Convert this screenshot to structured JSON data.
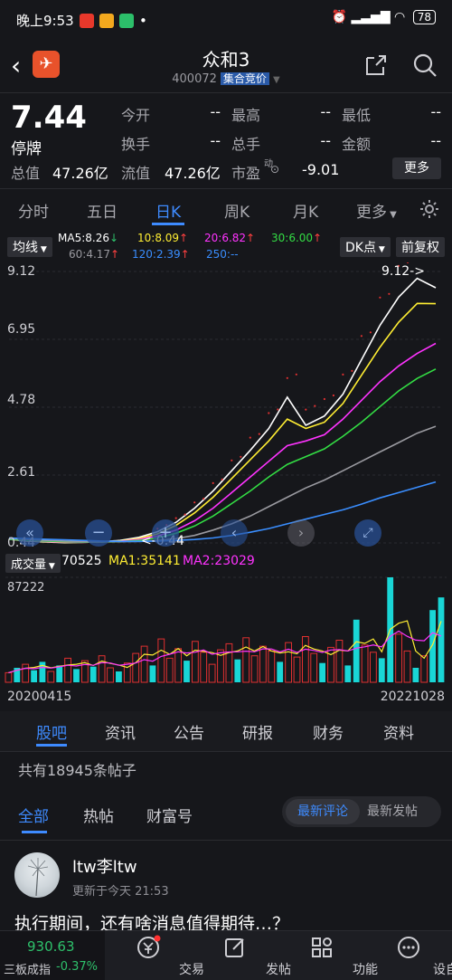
{
  "status_bar": {
    "time": "晚上9:53",
    "dot": "•",
    "battery": "78"
  },
  "header": {
    "title": "众和3",
    "code": "400072",
    "badge": "集合竞价"
  },
  "quote": {
    "price": "7.44",
    "state": "停牌",
    "fields": [
      {
        "label": "今开",
        "value": "--"
      },
      {
        "label": "最高",
        "value": "--"
      },
      {
        "label": "最低",
        "value": "--"
      },
      {
        "label": "换手",
        "value": "--"
      },
      {
        "label": "总手",
        "value": "--"
      },
      {
        "label": "金额",
        "value": "--"
      }
    ],
    "total_value_label": "总值",
    "total_value": "47.26亿",
    "float_value_label": "流值",
    "float_value": "47.26亿",
    "pe_label": "市盈",
    "pe_sup": "动",
    "pe_value": "-9.01",
    "more_label": "更多"
  },
  "chart_tabs": [
    {
      "label": "分时"
    },
    {
      "label": "五日"
    },
    {
      "label": "日K"
    },
    {
      "label": "周K"
    },
    {
      "label": "月K"
    },
    {
      "label": "更多"
    }
  ],
  "ma": {
    "selector": "均线",
    "ma5": "MA5:8.26",
    "ma10": "10:8.09",
    "ma20": "20:6.82",
    "ma30": "30:6.00",
    "ma60": "60:4.17",
    "ma120": "120:2.39",
    "ma250": "250:--",
    "dk_label": "DK点",
    "adjust_label": "前复权",
    "colors": {
      "ma5": "#ffffff",
      "ma10": "#ffee33",
      "ma20": "#ff33ff",
      "ma30": "#33dd44",
      "ma60": "#9a9aa0",
      "ma120": "#3a8eff",
      "ma250": "#3a8eff"
    }
  },
  "chart_data": {
    "type": "line",
    "title": "",
    "x_start": "20200415",
    "x_end": "20221028",
    "ylim": [
      0.44,
      9.12
    ],
    "y_ticks": [
      "9.12",
      "6.95",
      "4.78",
      "2.61",
      "0.44"
    ],
    "max_marker": "9.12->",
    "min_marker": "<-0.44",
    "series": [
      {
        "name": "MA5",
        "color": "#ffffff",
        "values": [
          0.56,
          0.5,
          0.47,
          0.45,
          0.46,
          0.48,
          0.52,
          0.62,
          0.8,
          1.1,
          1.55,
          2.1,
          2.75,
          3.4,
          4.1,
          5.1,
          4.2,
          4.5,
          5.2,
          6.3,
          7.4,
          8.3,
          8.9,
          8.6
        ]
      },
      {
        "name": "MA10",
        "color": "#ffee33",
        "values": [
          0.56,
          0.51,
          0.48,
          0.46,
          0.46,
          0.47,
          0.5,
          0.58,
          0.73,
          1.0,
          1.4,
          1.9,
          2.5,
          3.1,
          3.7,
          4.4,
          4.1,
          4.3,
          4.9,
          5.8,
          6.7,
          7.5,
          8.1,
          8.09
        ]
      },
      {
        "name": "MA20",
        "color": "#ff33ff",
        "values": [
          0.56,
          0.52,
          0.49,
          0.47,
          0.46,
          0.47,
          0.49,
          0.55,
          0.66,
          0.85,
          1.15,
          1.55,
          2.05,
          2.55,
          3.05,
          3.55,
          3.7,
          3.9,
          4.4,
          5.0,
          5.6,
          6.1,
          6.5,
          6.82
        ]
      },
      {
        "name": "MA30",
        "color": "#33dd44",
        "values": [
          0.56,
          0.52,
          0.5,
          0.48,
          0.47,
          0.47,
          0.48,
          0.52,
          0.6,
          0.75,
          0.98,
          1.3,
          1.7,
          2.1,
          2.55,
          2.95,
          3.2,
          3.45,
          3.85,
          4.3,
          4.8,
          5.3,
          5.7,
          6.0
        ]
      },
      {
        "name": "MA60",
        "color": "#9a9aa0",
        "values": [
          0.58,
          0.55,
          0.52,
          0.5,
          0.49,
          0.48,
          0.48,
          0.49,
          0.52,
          0.58,
          0.68,
          0.85,
          1.05,
          1.3,
          1.6,
          1.9,
          2.2,
          2.45,
          2.75,
          3.05,
          3.35,
          3.65,
          3.95,
          4.17
        ]
      },
      {
        "name": "MA120",
        "color": "#3a8eff",
        "values": [
          0.6,
          0.58,
          0.56,
          0.54,
          0.52,
          0.5,
          0.49,
          0.49,
          0.5,
          0.52,
          0.55,
          0.6,
          0.68,
          0.78,
          0.9,
          1.05,
          1.2,
          1.35,
          1.5,
          1.68,
          1.88,
          2.05,
          2.22,
          2.39
        ]
      }
    ]
  },
  "volume": {
    "selector": "成交量",
    "last": "70525",
    "ma1": "MA1:35141",
    "ma2": "MA2:23029",
    "max_label": "87222",
    "max": 87222,
    "bars": [
      {
        "v": 8000,
        "c": "#e03030"
      },
      {
        "v": 12000,
        "c": "#19d6d6"
      },
      {
        "v": 15000,
        "c": "#e03030"
      },
      {
        "v": 10000,
        "c": "#19d6d6"
      },
      {
        "v": 17000,
        "c": "#19d6d6"
      },
      {
        "v": 9000,
        "c": "#e03030"
      },
      {
        "v": 14000,
        "c": "#19d6d6"
      },
      {
        "v": 20000,
        "c": "#e03030"
      },
      {
        "v": 11000,
        "c": "#19d6d6"
      },
      {
        "v": 18000,
        "c": "#e03030"
      },
      {
        "v": 13000,
        "c": "#19d6d6"
      },
      {
        "v": 22000,
        "c": "#e03030"
      },
      {
        "v": 12000,
        "c": "#e03030"
      },
      {
        "v": 9000,
        "c": "#19d6d6"
      },
      {
        "v": 16000,
        "c": "#e03030"
      },
      {
        "v": 24000,
        "c": "#e03030"
      },
      {
        "v": 30000,
        "c": "#e03030"
      },
      {
        "v": 14000,
        "c": "#19d6d6"
      },
      {
        "v": 36000,
        "c": "#e03030"
      },
      {
        "v": 20000,
        "c": "#e03030"
      },
      {
        "v": 28000,
        "c": "#e03030"
      },
      {
        "v": 18000,
        "c": "#19d6d6"
      },
      {
        "v": 34000,
        "c": "#e03030"
      },
      {
        "v": 25000,
        "c": "#e03030"
      },
      {
        "v": 15000,
        "c": "#e03030"
      },
      {
        "v": 27000,
        "c": "#e03030"
      },
      {
        "v": 32000,
        "c": "#e03030"
      },
      {
        "v": 19000,
        "c": "#19d6d6"
      },
      {
        "v": 37000,
        "c": "#e03030"
      },
      {
        "v": 22000,
        "c": "#e03030"
      },
      {
        "v": 30000,
        "c": "#e03030"
      },
      {
        "v": 26000,
        "c": "#e03030"
      },
      {
        "v": 17000,
        "c": "#19d6d6"
      },
      {
        "v": 33000,
        "c": "#e03030"
      },
      {
        "v": 21000,
        "c": "#e03030"
      },
      {
        "v": 38000,
        "c": "#e03030"
      },
      {
        "v": 24000,
        "c": "#e03030"
      },
      {
        "v": 16000,
        "c": "#19d6d6"
      },
      {
        "v": 29000,
        "c": "#e03030"
      },
      {
        "v": 35000,
        "c": "#e03030"
      },
      {
        "v": 14000,
        "c": "#19d6d6"
      },
      {
        "v": 52000,
        "c": "#19d6d6"
      },
      {
        "v": 31000,
        "c": "#e03030"
      },
      {
        "v": 25000,
        "c": "#e03030"
      },
      {
        "v": 20000,
        "c": "#19d6d6"
      },
      {
        "v": 87222,
        "c": "#19d6d6"
      },
      {
        "v": 40000,
        "c": "#e03030"
      },
      {
        "v": 26000,
        "c": "#e03030"
      },
      {
        "v": 12000,
        "c": "#19d6d6"
      },
      {
        "v": 22000,
        "c": "#e03030"
      },
      {
        "v": 60000,
        "c": "#19d6d6"
      },
      {
        "v": 70525,
        "c": "#19d6d6"
      }
    ]
  },
  "date_start": "20200415",
  "date_end": "20221028",
  "info_tabs": [
    {
      "label": "股吧"
    },
    {
      "label": "资讯"
    },
    {
      "label": "公告"
    },
    {
      "label": "研报"
    },
    {
      "label": "财务"
    },
    {
      "label": "资料"
    }
  ],
  "post_count": "共有18945条帖子",
  "forum_tabs": [
    {
      "label": "全部"
    },
    {
      "label": "热帖"
    },
    {
      "label": "财富号"
    }
  ],
  "sort": {
    "latest_comment": "最新评论",
    "latest_post": "最新发帖"
  },
  "post": {
    "user": "ltw李ltw",
    "updated": "更新于今天 21:53",
    "title": "执行期间，还有啥消息值得期待…？"
  },
  "bottom": {
    "index_value": "930.63",
    "index_name": "三板成指",
    "index_change": "-0.37%",
    "nav": [
      {
        "label": "交易"
      },
      {
        "label": "发帖"
      },
      {
        "label": "功能"
      },
      {
        "label": "设自选"
      }
    ]
  }
}
